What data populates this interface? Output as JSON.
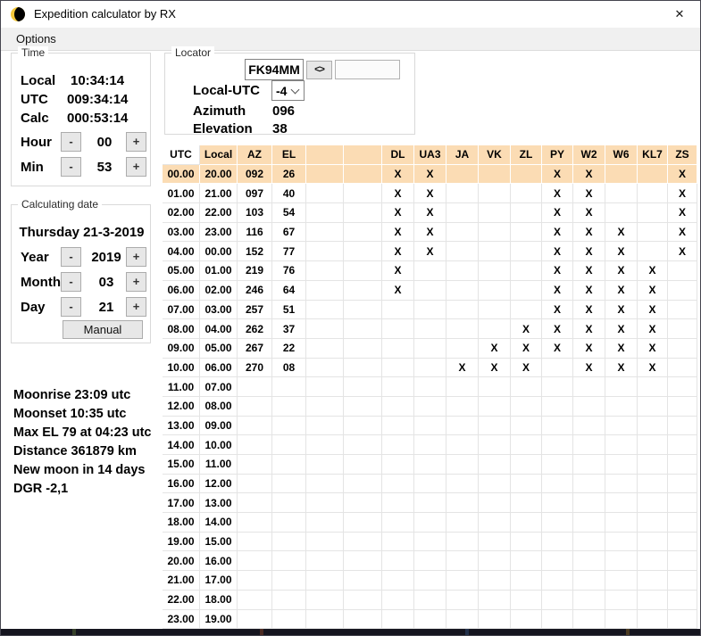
{
  "window": {
    "title": "Expedition calculator by RX",
    "close_glyph": "✕"
  },
  "menu": {
    "items": [
      {
        "label": "Options"
      }
    ]
  },
  "glyphs": {
    "minus": "-",
    "plus": "+"
  },
  "time": {
    "title": "Time",
    "local_label": "Local",
    "local_value": "10:34:14",
    "utc_label": "UTC",
    "utc_value": "009:34:14",
    "calc_label": "Calc",
    "calc_value": "000:53:14",
    "hour_label": "Hour",
    "hour_value": "00",
    "min_label": "Min",
    "min_value": "53"
  },
  "locator": {
    "title": "Locator",
    "grid_value": "FK94MM",
    "swap_button_label": "<>",
    "target_value": "",
    "local_utc_label": "Local-UTC",
    "local_utc_value": "-4",
    "azimuth_label": "Azimuth",
    "azimuth_value": "096",
    "elevation_label": "Elevation",
    "elevation_value": "38"
  },
  "date": {
    "title": "Calculating date",
    "date_text": "Thursday 21-3-2019",
    "year_label": "Year",
    "year_value": "2019",
    "month_label": "Month",
    "month_value": "03",
    "day_label": "Day",
    "day_value": "21",
    "manual_button_label": "Manual"
  },
  "moon_info": {
    "lines": [
      "Moonrise 23:09 utc",
      "Moonset 10:35 utc",
      "Max EL 79 at 04:23 utc",
      "Distance 361879 km",
      "New moon in 14 days",
      "DGR -2,1"
    ]
  },
  "table": {
    "headers": [
      "UTC",
      "Local",
      "AZ",
      "EL",
      "",
      "",
      "DL",
      "UA3",
      "JA",
      "VK",
      "ZL",
      "PY",
      "W2",
      "W6",
      "KL7",
      "ZS"
    ],
    "highlight_row": 0,
    "mark_glyph": "X",
    "rows": [
      [
        "00.00",
        "20.00",
        "092",
        "26",
        "",
        "",
        "X",
        "X",
        "",
        "",
        "",
        "X",
        "X",
        "",
        "",
        "X"
      ],
      [
        "01.00",
        "21.00",
        "097",
        "40",
        "",
        "",
        "X",
        "X",
        "",
        "",
        "",
        "X",
        "X",
        "",
        "",
        "X"
      ],
      [
        "02.00",
        "22.00",
        "103",
        "54",
        "",
        "",
        "X",
        "X",
        "",
        "",
        "",
        "X",
        "X",
        "",
        "",
        "X"
      ],
      [
        "03.00",
        "23.00",
        "116",
        "67",
        "",
        "",
        "X",
        "X",
        "",
        "",
        "",
        "X",
        "X",
        "X",
        "",
        "X"
      ],
      [
        "04.00",
        "00.00",
        "152",
        "77",
        "",
        "",
        "X",
        "X",
        "",
        "",
        "",
        "X",
        "X",
        "X",
        "",
        "X"
      ],
      [
        "05.00",
        "01.00",
        "219",
        "76",
        "",
        "",
        "X",
        "",
        "",
        "",
        "",
        "X",
        "X",
        "X",
        "X",
        ""
      ],
      [
        "06.00",
        "02.00",
        "246",
        "64",
        "",
        "",
        "X",
        "",
        "",
        "",
        "",
        "X",
        "X",
        "X",
        "X",
        ""
      ],
      [
        "07.00",
        "03.00",
        "257",
        "51",
        "",
        "",
        "",
        "",
        "",
        "",
        "",
        "X",
        "X",
        "X",
        "X",
        ""
      ],
      [
        "08.00",
        "04.00",
        "262",
        "37",
        "",
        "",
        "",
        "",
        "",
        "",
        "X",
        "X",
        "X",
        "X",
        "X",
        ""
      ],
      [
        "09.00",
        "05.00",
        "267",
        "22",
        "",
        "",
        "",
        "",
        "",
        "X",
        "X",
        "X",
        "X",
        "X",
        "X",
        ""
      ],
      [
        "10.00",
        "06.00",
        "270",
        "08",
        "",
        "",
        "",
        "",
        "X",
        "X",
        "X",
        "",
        "X",
        "X",
        "X",
        ""
      ],
      [
        "11.00",
        "07.00",
        "",
        "",
        "",
        "",
        "",
        "",
        "",
        "",
        "",
        "",
        "",
        "",
        "",
        ""
      ],
      [
        "12.00",
        "08.00",
        "",
        "",
        "",
        "",
        "",
        "",
        "",
        "",
        "",
        "",
        "",
        "",
        "",
        ""
      ],
      [
        "13.00",
        "09.00",
        "",
        "",
        "",
        "",
        "",
        "",
        "",
        "",
        "",
        "",
        "",
        "",
        "",
        ""
      ],
      [
        "14.00",
        "10.00",
        "",
        "",
        "",
        "",
        "",
        "",
        "",
        "",
        "",
        "",
        "",
        "",
        "",
        ""
      ],
      [
        "15.00",
        "11.00",
        "",
        "",
        "",
        "",
        "",
        "",
        "",
        "",
        "",
        "",
        "",
        "",
        "",
        ""
      ],
      [
        "16.00",
        "12.00",
        "",
        "",
        "",
        "",
        "",
        "",
        "",
        "",
        "",
        "",
        "",
        "",
        "",
        ""
      ],
      [
        "17.00",
        "13.00",
        "",
        "",
        "",
        "",
        "",
        "",
        "",
        "",
        "",
        "",
        "",
        "",
        "",
        ""
      ],
      [
        "18.00",
        "14.00",
        "",
        "",
        "",
        "",
        "",
        "",
        "",
        "",
        "",
        "",
        "",
        "",
        "",
        ""
      ],
      [
        "19.00",
        "15.00",
        "",
        "",
        "",
        "",
        "",
        "",
        "",
        "",
        "",
        "",
        "",
        "",
        "",
        ""
      ],
      [
        "20.00",
        "16.00",
        "",
        "",
        "",
        "",
        "",
        "",
        "",
        "",
        "",
        "",
        "",
        "",
        "",
        ""
      ],
      [
        "21.00",
        "17.00",
        "",
        "",
        "",
        "",
        "",
        "",
        "",
        "",
        "",
        "",
        "",
        "",
        "",
        ""
      ],
      [
        "22.00",
        "18.00",
        "",
        "",
        "",
        "",
        "",
        "",
        "",
        "",
        "",
        "",
        "",
        "",
        "",
        ""
      ],
      [
        "23.00",
        "19.00",
        "",
        "",
        "",
        "",
        "",
        "",
        "",
        "",
        "",
        "",
        "",
        "",
        "",
        ""
      ]
    ]
  },
  "colors": {
    "highlight_peach": "#fbdcb4",
    "gridline": "#e4e4e4",
    "menu_bg": "#f0f0f0",
    "moon_yellow": "#f3c73a",
    "bottom_strip": "#15151f"
  }
}
